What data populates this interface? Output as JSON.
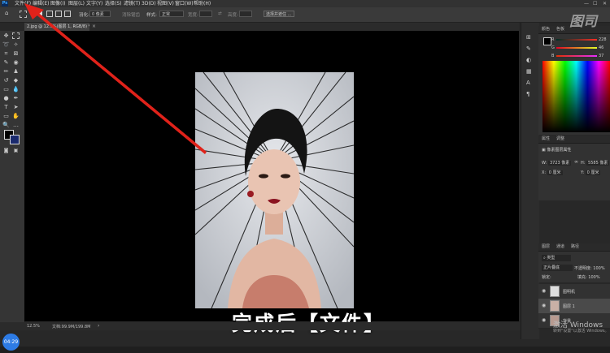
{
  "menubar": {
    "items": [
      "文件(F)",
      "编辑(E)",
      "图像(I)",
      "图层(L)",
      "文字(Y)",
      "选择(S)",
      "滤镜(T)",
      "3D(D)",
      "视图(V)",
      "窗口(W)",
      "帮助(H)"
    ]
  },
  "options": {
    "feather_label": "羽化:",
    "feather_value": "0 像素",
    "antialias_label": "消除锯齿",
    "style_label": "样式:",
    "style_value": "正常",
    "width_label": "宽度:",
    "height_label": "高度:",
    "select_mask_button": "选择并遮住 ..."
  },
  "document": {
    "tab_title": "2.jpg @ 12.5%(图层 1, RGB/8) *"
  },
  "status": {
    "zoom": "12.5%",
    "doc_info": "文档:99.9M/199.8M"
  },
  "subtitle": "完成后【文件】",
  "color_panel": {
    "tabs": [
      "颜色",
      "色板"
    ],
    "r_value": "228",
    "g_value": "46",
    "b_value": "37"
  },
  "properties_panel": {
    "tabs": [
      "属性",
      "调整"
    ],
    "heading": "像素图层属性",
    "w_label": "W:",
    "w_value": "3723 像素",
    "h_label": "H:",
    "h_value": "5585 像素",
    "x_label": "X:",
    "x_value": "0 厘米",
    "y_label": "Y:",
    "y_value": "0 厘米"
  },
  "layers_panel": {
    "tabs": [
      "图层",
      "通道",
      "路径"
    ],
    "filter_label": "类型",
    "blend_mode": "正片叠底",
    "opacity_label": "不透明度:",
    "opacity_value": "100%",
    "lock_label": "锁定:",
    "fill_label": "填充:",
    "fill_value": "100%",
    "layers": [
      {
        "name": "图明机"
      },
      {
        "name": "图层 1"
      },
      {
        "name": "背景"
      }
    ]
  },
  "watermark": "图司",
  "windows_activation": {
    "title": "激活 Windows",
    "subtitle": "转到\"设置\"以激活 Windows。"
  },
  "timer": "04:29",
  "colors": {
    "accent": "#2d7be5",
    "arrow": "#e0221a"
  }
}
